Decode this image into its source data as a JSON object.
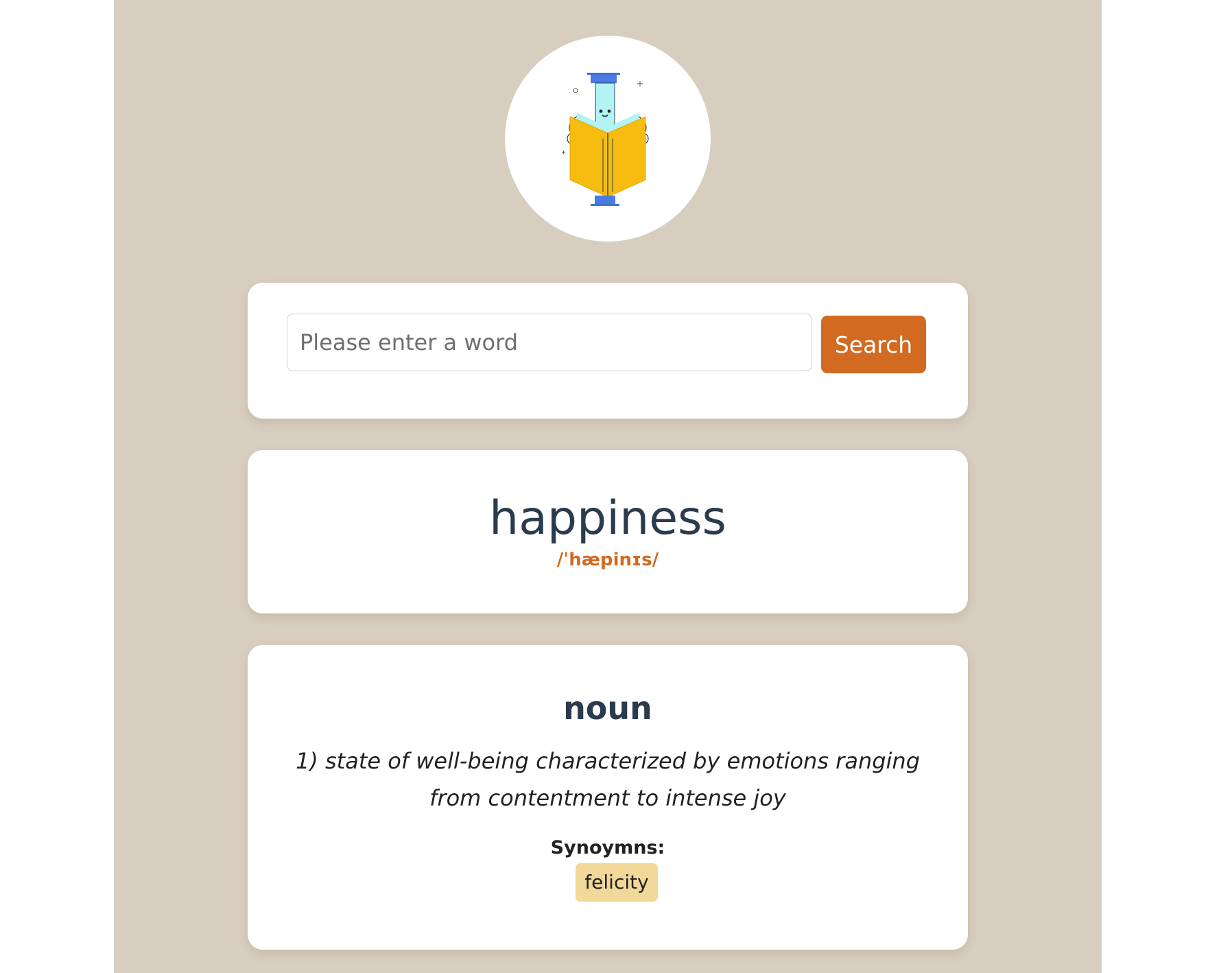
{
  "search": {
    "placeholder": "Please enter a word",
    "value": "",
    "button_label": "Search"
  },
  "word": {
    "text": "happiness",
    "phonetic": "/ˈhæpinɪs/"
  },
  "meanings": [
    {
      "part_of_speech": "noun",
      "definitions": [
        {
          "text": "1) state of well-being characterized by emotions ranging from contentment to intense joy"
        }
      ],
      "synonyms_label": "Synoymns:",
      "synonyms": [
        "felicity"
      ]
    }
  ],
  "logo": {
    "icon": "reading-book-character-icon"
  },
  "colors": {
    "page_background": "#d8cebf",
    "accent": "#d26a21",
    "heading_text": "#2b3b4e",
    "synonym_chip": "#f2d999"
  }
}
